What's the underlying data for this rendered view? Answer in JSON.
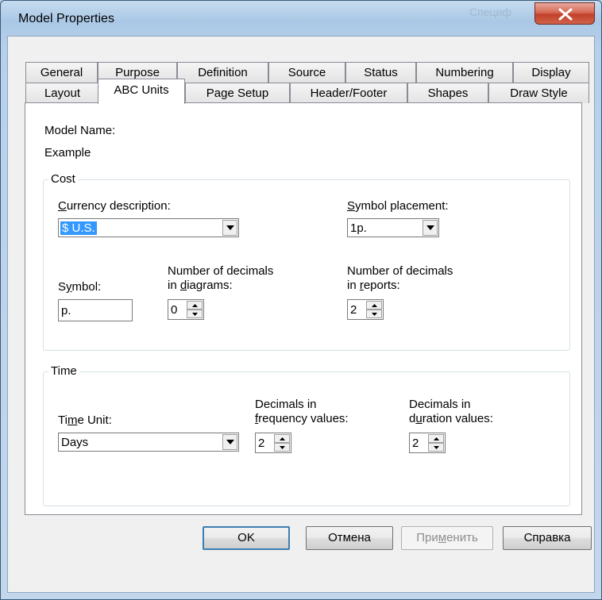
{
  "window": {
    "title": "Model Properties",
    "background_title_fragment": "Специф"
  },
  "tabs_row1": [
    "General",
    "Purpose",
    "Definition",
    "Source",
    "Status",
    "Numbering",
    "Display"
  ],
  "tabs_row2": [
    "Layout",
    "ABC Units",
    "Page Setup",
    "Header/Footer",
    "Shapes",
    "Draw Style"
  ],
  "active_tab": "ABC Units",
  "model": {
    "name_label": "Model Name:",
    "name_value": "Example"
  },
  "cost": {
    "group_label": "Cost",
    "currency_label_u": "C",
    "currency_label_rest": "urrency description:",
    "currency_value": "$ U.S.",
    "placement_label_u": "S",
    "placement_label_rest": "ymbol placement:",
    "placement_value": "1p.",
    "symbol_label_pre": "S",
    "symbol_label_u": "y",
    "symbol_label_post": "mbol:",
    "symbol_value": "p.",
    "diagrams_label_line1": "Number of decimals",
    "diagrams_label_pre": "in ",
    "diagrams_label_u": "d",
    "diagrams_label_post": "iagrams:",
    "diagrams_value": "0",
    "reports_label_line1": "Number of decimals",
    "reports_label_pre": "in ",
    "reports_label_u": "r",
    "reports_label_post": "eports:",
    "reports_value": "2"
  },
  "time": {
    "group_label": "Time",
    "unit_label_pre": "Ti",
    "unit_label_u": "m",
    "unit_label_post": "e Unit:",
    "unit_value": "Days",
    "freq_label_line1": "Decimals in",
    "freq_label_u": "f",
    "freq_label_post": "requency values:",
    "freq_value": "2",
    "dur_label_line1": "Decimals in",
    "dur_label_pre": "d",
    "dur_label_u": "u",
    "dur_label_post": "ration values:",
    "dur_value": "2"
  },
  "buttons": {
    "ok": "OK",
    "cancel": "Отмена",
    "apply_pre": "При",
    "apply_u": "м",
    "apply_post": "енить",
    "help": "Справка"
  }
}
